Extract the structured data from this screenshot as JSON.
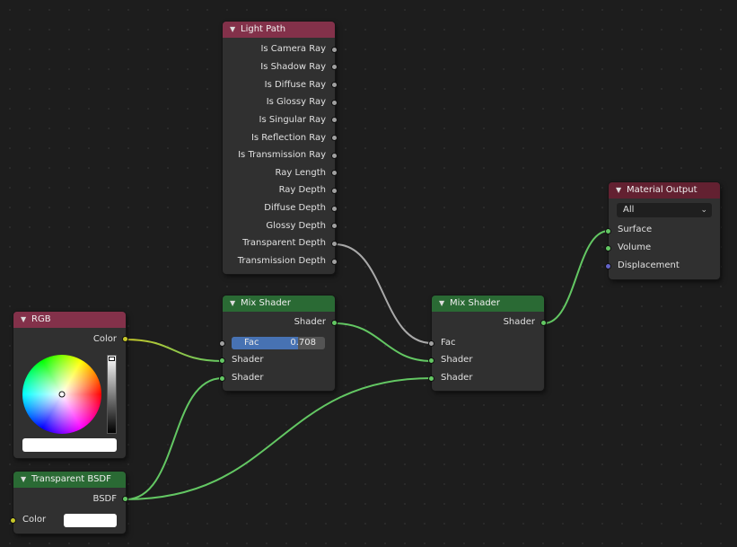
{
  "nodes": {
    "light_path": {
      "title": "Light Path",
      "outputs": [
        "Is Camera Ray",
        "Is Shadow Ray",
        "Is Diffuse Ray",
        "Is Glossy Ray",
        "Is Singular Ray",
        "Is Reflection Ray",
        "Is Transmission Ray",
        "Ray Length",
        "Ray Depth",
        "Diffuse Depth",
        "Glossy Depth",
        "Transparent Depth",
        "Transmission Depth"
      ]
    },
    "rgb": {
      "title": "RGB",
      "output": "Color",
      "color": "#ffffff"
    },
    "transparent_bsdf": {
      "title": "Transparent BSDF",
      "output": "BSDF",
      "input": "Color",
      "color": "#ffffff"
    },
    "mix_shader_1": {
      "title": "Mix Shader",
      "output": "Shader",
      "fac_label": "Fac",
      "fac_value": "0.708",
      "fac": 0.708,
      "input_a": "Shader",
      "input_b": "Shader"
    },
    "mix_shader_2": {
      "title": "Mix Shader",
      "output": "Shader",
      "fac_label": "Fac",
      "input_a": "Shader",
      "input_b": "Shader"
    },
    "material_output": {
      "title": "Material Output",
      "target": "All",
      "inputs": [
        "Surface",
        "Volume",
        "Displacement"
      ]
    }
  },
  "colors": {
    "input_header": "#83314a",
    "shader_header": "#2a6a34",
    "output_header": "#632131",
    "shader_socket": "#63c763",
    "color_socket": "#c7c729",
    "float_socket": "#a1a1a1",
    "vector_socket": "#6363c7",
    "slider_fill": "#4772b3"
  }
}
